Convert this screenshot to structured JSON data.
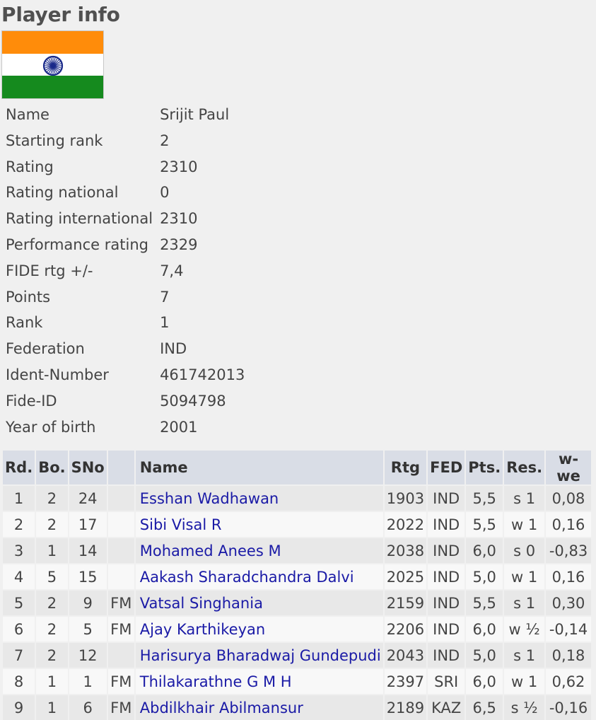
{
  "page": {
    "title": "Player info"
  },
  "flag": {
    "icon": "india-flag-icon",
    "colors": [
      "#ff8c0a",
      "#ffffff",
      "#158a1e"
    ],
    "chakra": "#1a2a8a"
  },
  "info": [
    {
      "label": "Name",
      "value": "Srijit Paul"
    },
    {
      "label": "Starting rank",
      "value": "2"
    },
    {
      "label": "Rating",
      "value": "2310"
    },
    {
      "label": "Rating national",
      "value": "0"
    },
    {
      "label": "Rating international",
      "value": "2310"
    },
    {
      "label": "Performance rating",
      "value": "2329"
    },
    {
      "label": "FIDE rtg +/-",
      "value": "7,4"
    },
    {
      "label": "Points",
      "value": "7"
    },
    {
      "label": "Rank",
      "value": "1"
    },
    {
      "label": "Federation",
      "value": "IND"
    },
    {
      "label": "Ident-Number",
      "value": "461742013"
    },
    {
      "label": "Fide-ID",
      "value": "5094798"
    },
    {
      "label": "Year of birth",
      "value": "2001"
    }
  ],
  "games": {
    "headers": {
      "rd": "Rd.",
      "bo": "Bo.",
      "sno": "SNo",
      "title": "",
      "name": "Name",
      "rtg": "Rtg",
      "fed": "FED",
      "pts": "Pts.",
      "res": "Res.",
      "wwe": "w-we"
    },
    "rows": [
      {
        "rd": "1",
        "bo": "2",
        "sno": "24",
        "title": "",
        "name": "Esshan Wadhawan",
        "rtg": "1903",
        "fed": "IND",
        "pts": "5,5",
        "res": "s 1",
        "wwe": "0,08"
      },
      {
        "rd": "2",
        "bo": "2",
        "sno": "17",
        "title": "",
        "name": "Sibi Visal R",
        "rtg": "2022",
        "fed": "IND",
        "pts": "5,5",
        "res": "w 1",
        "wwe": "0,16"
      },
      {
        "rd": "3",
        "bo": "1",
        "sno": "14",
        "title": "",
        "name": "Mohamed Anees M",
        "rtg": "2038",
        "fed": "IND",
        "pts": "6,0",
        "res": "s 0",
        "wwe": "-0,83"
      },
      {
        "rd": "4",
        "bo": "5",
        "sno": "15",
        "title": "",
        "name": "Aakash Sharadchandra Dalvi",
        "rtg": "2025",
        "fed": "IND",
        "pts": "5,0",
        "res": "w 1",
        "wwe": "0,16"
      },
      {
        "rd": "5",
        "bo": "2",
        "sno": "9",
        "title": "FM",
        "name": "Vatsal Singhania",
        "rtg": "2159",
        "fed": "IND",
        "pts": "5,5",
        "res": "s 1",
        "wwe": "0,30"
      },
      {
        "rd": "6",
        "bo": "2",
        "sno": "5",
        "title": "FM",
        "name": "Ajay Karthikeyan",
        "rtg": "2206",
        "fed": "IND",
        "pts": "6,0",
        "res": "w ½",
        "wwe": "-0,14"
      },
      {
        "rd": "7",
        "bo": "2",
        "sno": "12",
        "title": "",
        "name": "Harisurya Bharadwaj Gundepudi",
        "rtg": "2043",
        "fed": "IND",
        "pts": "5,0",
        "res": "s 1",
        "wwe": "0,18"
      },
      {
        "rd": "8",
        "bo": "1",
        "sno": "1",
        "title": "FM",
        "name": "Thilakarathne G M H",
        "rtg": "2397",
        "fed": "SRI",
        "pts": "6,0",
        "res": "w 1",
        "wwe": "0,62"
      },
      {
        "rd": "9",
        "bo": "1",
        "sno": "6",
        "title": "FM",
        "name": "Abdilkhair Abilmansur",
        "rtg": "2189",
        "fed": "KAZ",
        "pts": "6,5",
        "res": "s ½",
        "wwe": "-0,16"
      }
    ]
  }
}
